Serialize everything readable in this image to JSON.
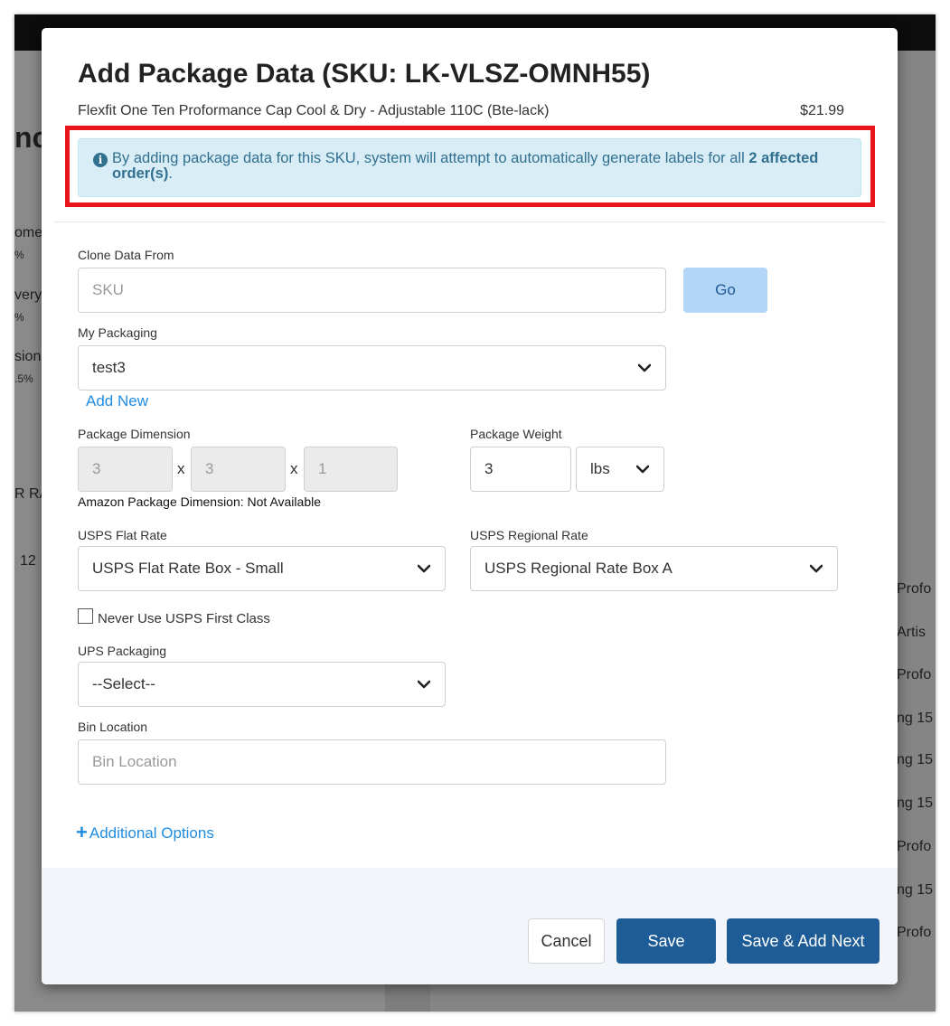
{
  "modal": {
    "title": "Add Package Data (SKU: LK-VLSZ-OMNH55)",
    "product_name": "Flexfit One Ten Proformance Cap Cool & Dry - Adjustable 110C (Bte-lack)",
    "product_price": "$21.99"
  },
  "alert": {
    "icon": "info-icon",
    "text_before": "By adding package data for this SKU, system will attempt to automatically generate labels for all ",
    "text_bold": "2 affected order(s)",
    "text_after": "."
  },
  "clone": {
    "label": "Clone Data From",
    "placeholder": "SKU",
    "go_label": "Go"
  },
  "packaging": {
    "label": "My Packaging",
    "value": "test3",
    "add_new": "Add New"
  },
  "dimension": {
    "label": "Package Dimension",
    "length": "3",
    "width": "3",
    "height": "1",
    "separator": "x",
    "amazon_note": "Amazon Package Dimension: Not Available"
  },
  "weight": {
    "label": "Package Weight",
    "value": "3",
    "unit": "lbs"
  },
  "usps_flat": {
    "label": "USPS Flat Rate",
    "value": "USPS Flat Rate Box - Small"
  },
  "usps_regional": {
    "label": "USPS Regional Rate",
    "value": "USPS Regional Rate Box A"
  },
  "first_class": {
    "label": "Never Use USPS First Class",
    "checked": false
  },
  "ups": {
    "label": "UPS Packaging",
    "value": "--Select--"
  },
  "bin": {
    "label": "Bin Location",
    "placeholder": "Bin Location"
  },
  "additional": {
    "label": "Additional Options"
  },
  "footer": {
    "cancel": "Cancel",
    "save": "Save",
    "save_next": "Save & Add Next"
  },
  "background": {
    "heading_fragment": "nc",
    "left_labels": [
      "ome",
      "%",
      "very",
      "%",
      "sion",
      ".5%",
      "R RA",
      "12"
    ],
    "right_labels": [
      "Profo",
      "Artis",
      "Profo",
      "ng 15",
      "ng 15",
      "ng 15",
      "Profo",
      "ng 15",
      "Profo"
    ]
  },
  "colors": {
    "primary": "#1d5c96",
    "link": "#1f8ce0",
    "alert_bg": "#d9edf7",
    "alert_text": "#31708f",
    "highlight_border": "#e8141b"
  }
}
